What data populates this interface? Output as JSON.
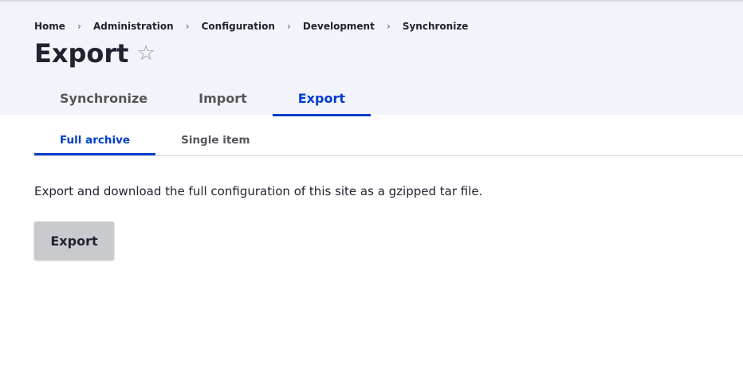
{
  "breadcrumb": {
    "items": [
      "Home",
      "Administration",
      "Configuration",
      "Development",
      "Synchronize"
    ],
    "separator": "›"
  },
  "page": {
    "title": "Export",
    "favorite_icon": "star-outline-icon"
  },
  "primary_tabs": [
    {
      "label": "Synchronize",
      "active": false
    },
    {
      "label": "Import",
      "active": false
    },
    {
      "label": "Export",
      "active": true
    }
  ],
  "secondary_tabs": [
    {
      "label": "Full archive",
      "active": true
    },
    {
      "label": "Single item",
      "active": false
    }
  ],
  "content": {
    "description": "Export and download the full configuration of this site as a gzipped tar file.",
    "export_button_label": "Export"
  },
  "colors": {
    "accent": "#003ecc",
    "header_background": "#f3f4f9",
    "button_background": "#c9cace",
    "text": "#222330"
  }
}
